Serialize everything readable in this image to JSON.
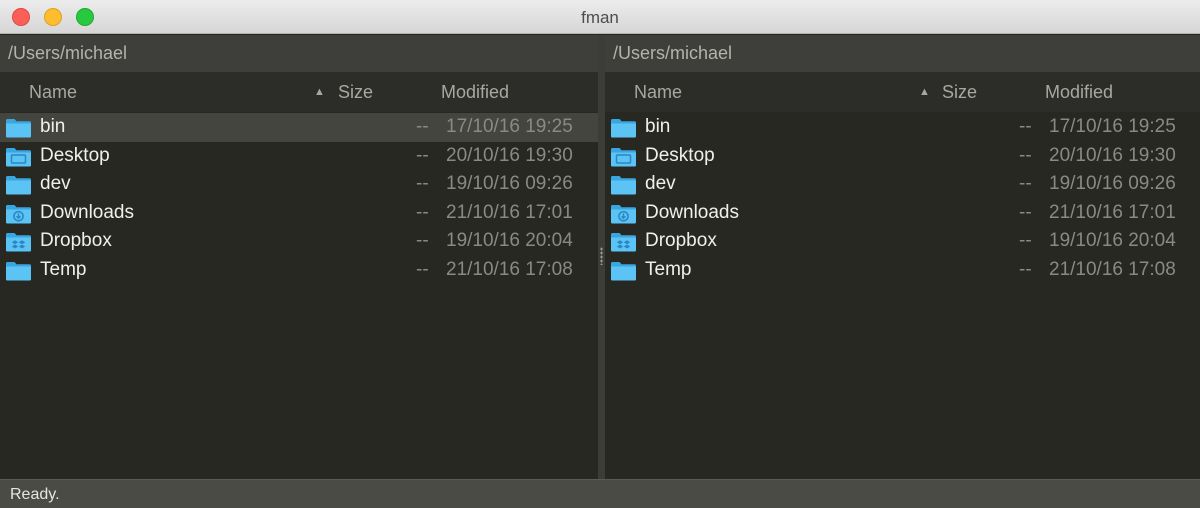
{
  "window": {
    "title": "fman"
  },
  "colors": {
    "folder": "#5cc3f5",
    "folder_dark": "#3aa6e0",
    "background": "#272822"
  },
  "panes": {
    "left": {
      "path": "/Users/michael",
      "columns": {
        "name": "Name",
        "size": "Size",
        "modified": "Modified"
      },
      "sort_indicator": "▲",
      "files": [
        {
          "name": "bin",
          "size": "--",
          "modified": "17/10/16 19:25",
          "icon": "folder-icon"
        },
        {
          "name": "Desktop",
          "size": "--",
          "modified": "20/10/16 19:30",
          "icon": "desktop-folder-icon"
        },
        {
          "name": "dev",
          "size": "--",
          "modified": "19/10/16 09:26",
          "icon": "folder-icon"
        },
        {
          "name": "Downloads",
          "size": "--",
          "modified": "21/10/16 17:01",
          "icon": "downloads-folder-icon"
        },
        {
          "name": "Dropbox",
          "size": "--",
          "modified": "19/10/16 20:04",
          "icon": "dropbox-folder-icon"
        },
        {
          "name": "Temp",
          "size": "--",
          "modified": "21/10/16 17:08",
          "icon": "folder-icon"
        }
      ]
    },
    "right": {
      "path": "/Users/michael",
      "columns": {
        "name": "Name",
        "size": "Size",
        "modified": "Modified"
      },
      "sort_indicator": "▲",
      "files": [
        {
          "name": "bin",
          "size": "--",
          "modified": "17/10/16 19:25",
          "icon": "folder-icon"
        },
        {
          "name": "Desktop",
          "size": "--",
          "modified": "20/10/16 19:30",
          "icon": "desktop-folder-icon"
        },
        {
          "name": "dev",
          "size": "--",
          "modified": "19/10/16 09:26",
          "icon": "folder-icon"
        },
        {
          "name": "Downloads",
          "size": "--",
          "modified": "21/10/16 17:01",
          "icon": "downloads-folder-icon"
        },
        {
          "name": "Dropbox",
          "size": "--",
          "modified": "19/10/16 20:04",
          "icon": "dropbox-folder-icon"
        },
        {
          "name": "Temp",
          "size": "--",
          "modified": "21/10/16 17:08",
          "icon": "folder-icon"
        }
      ]
    }
  },
  "status": {
    "text": "Ready."
  }
}
